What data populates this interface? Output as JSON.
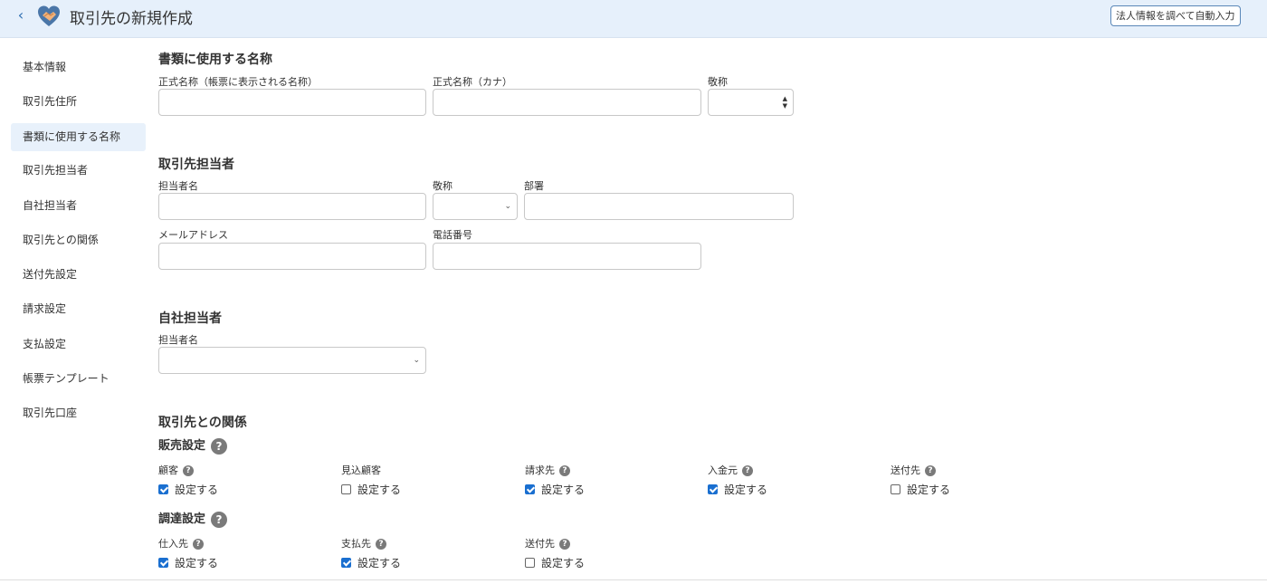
{
  "header": {
    "back_glyph": "‹",
    "title": "取引先の新規作成",
    "autofill_label": "法人情報を調べて自動入力"
  },
  "sidebar": {
    "items": [
      {
        "label": "基本情報",
        "active": false
      },
      {
        "label": "取引先住所",
        "active": false
      },
      {
        "label": "書類に使用する名称",
        "active": true
      },
      {
        "label": "取引先担当者",
        "active": false
      },
      {
        "label": "自社担当者",
        "active": false
      },
      {
        "label": "取引先との関係",
        "active": false
      },
      {
        "label": "送付先設定",
        "active": false
      },
      {
        "label": "請求設定",
        "active": false
      },
      {
        "label": "支払設定",
        "active": false
      },
      {
        "label": "帳票テンプレート",
        "active": false
      },
      {
        "label": "取引先口座",
        "active": false
      }
    ]
  },
  "doc_names": {
    "title": "書類に使用する名称",
    "official_name_label": "正式名称（帳票に表示される名称）",
    "official_name_value": "",
    "official_kana_label": "正式名称（カナ）",
    "official_kana_value": "",
    "honorific_label": "敬称",
    "honorific_value": ""
  },
  "partner_contact": {
    "title": "取引先担当者",
    "name_label": "担当者名",
    "name_value": "",
    "honorific_label": "敬称",
    "honorific_value": "",
    "dept_label": "部署",
    "dept_value": "",
    "email_label": "メールアドレス",
    "email_value": "",
    "phone_label": "電話番号",
    "phone_value": ""
  },
  "own_contact": {
    "title": "自社担当者",
    "name_label": "担当者名",
    "name_value": ""
  },
  "relationship": {
    "title": "取引先との関係",
    "sales": {
      "title": "販売設定",
      "help_glyph": "?",
      "items": [
        {
          "label": "顧客",
          "help": true,
          "checkbox_label": "設定する",
          "checked": true
        },
        {
          "label": "見込顧客",
          "help": false,
          "checkbox_label": "設定する",
          "checked": false
        },
        {
          "label": "請求先",
          "help": true,
          "checkbox_label": "設定する",
          "checked": true
        },
        {
          "label": "入金元",
          "help": true,
          "checkbox_label": "設定する",
          "checked": true
        },
        {
          "label": "送付先",
          "help": true,
          "checkbox_label": "設定する",
          "checked": false
        }
      ]
    },
    "procurement": {
      "title": "調達設定",
      "help_glyph": "?",
      "items": [
        {
          "label": "仕入先",
          "help": true,
          "checkbox_label": "設定する",
          "checked": true
        },
        {
          "label": "支払先",
          "help": true,
          "checkbox_label": "設定する",
          "checked": true
        },
        {
          "label": "送付先",
          "help": true,
          "checkbox_label": "設定する",
          "checked": false
        }
      ]
    }
  },
  "icons": {
    "back": "chevron-left-icon",
    "logo": "handshake-heart-icon",
    "help": "question-circle-icon",
    "select": "chevron-down-icon"
  },
  "colors": {
    "header_bg": "#e6f0fb",
    "active_nav_bg": "#e8f1fb",
    "checkbox_on": "#1a6fd0",
    "autofill_border": "#5a87b8"
  }
}
